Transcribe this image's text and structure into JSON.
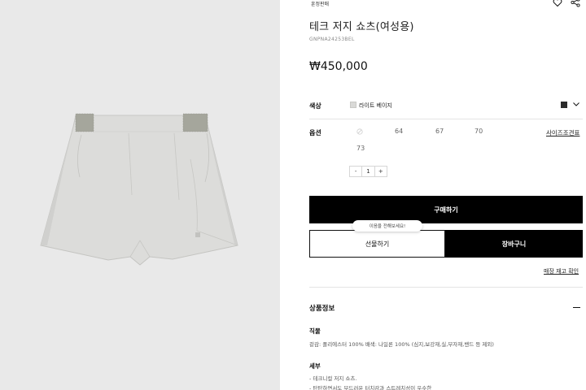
{
  "brand": "훈정판매",
  "product": {
    "name": "테크 저지 쇼츠(여성용)",
    "code": "GNPNA24253BEL",
    "price": "₩450,000"
  },
  "color_option": {
    "label": "색상",
    "selected": "라이트 베이지",
    "swatch_color": "#d9d9d7",
    "chip_color": "#2b2b2b"
  },
  "size_option": {
    "label": "옵션",
    "sizes": [
      "64",
      "67",
      "70",
      "73"
    ],
    "size_chart_link": "사이즈조견표"
  },
  "quantity": {
    "minus": "-",
    "value": "1",
    "plus": "+"
  },
  "actions": {
    "buy": "구매하기",
    "tooltip": "이음을 전해보세요!",
    "gift": "선물하기",
    "cart": "장바구니",
    "stock_link": "매장 재고 확인"
  },
  "info": {
    "section_title": "상품정보",
    "fabric_title": "직물",
    "fabric_text": "겉감: 폴리에스터 100% 배색: 나일론 100% (심지,보강재,실,부자재,밴드 등 제외)",
    "detail_title": "세부",
    "detail_lines": [
      "- 테크니컬 저지 쇼츠.",
      "- 탄탄하면서도 부드러운 터치감과 스트레치성이 우수한"
    ]
  }
}
